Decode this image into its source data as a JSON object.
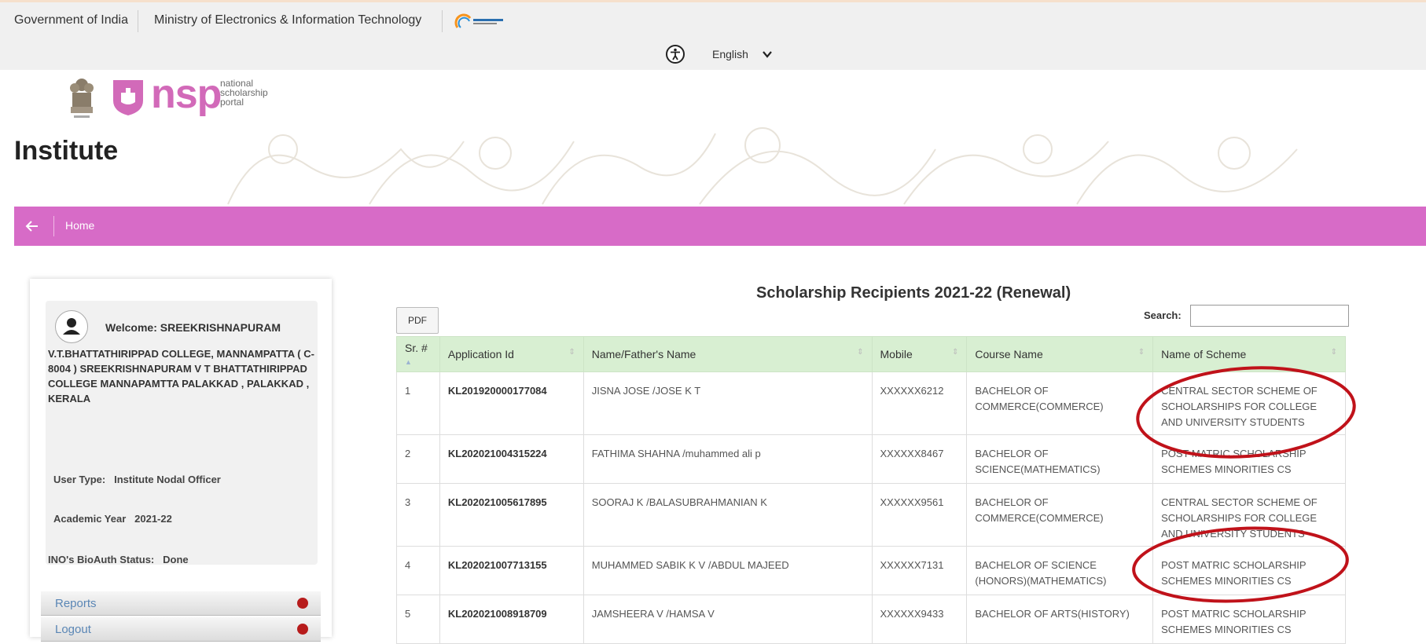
{
  "topbar": {
    "gov": "Government of India",
    "ministry": "Ministry of Electronics & Information Technology",
    "digital_logo": "Digital India",
    "language": "English",
    "accessibility_icon": "accessibility-icon",
    "chevron_icon": "chevron-down-icon"
  },
  "brand": {
    "logo_text": "nsp",
    "logo_sub": [
      "national",
      "scholarship",
      "portal"
    ]
  },
  "page": {
    "title": "Institute"
  },
  "nav": {
    "back_icon": "arrow-left-icon",
    "home": "Home"
  },
  "sidebar": {
    "welcome": "Welcome: SREEKRISHNAPURAM",
    "college": "V.T.BHATTATHIRIPPAD COLLEGE, MANNAMPATTA ( C-8004 ) SREEKRISHNAPURAM V T BHATTATHIRIPPAD COLLEGE MANNAPAMTTA PALAKKAD , PALAKKAD , KERALA",
    "user_type_label": "User Type:",
    "user_type": "Institute Nodal Officer",
    "academic_year_label": "Academic Year",
    "academic_year": "2021-22",
    "bioauth_label": "INO's BioAuth Status:",
    "bioauth": "Done",
    "menu": [
      {
        "label": "Reports"
      },
      {
        "label": "Logout"
      }
    ]
  },
  "report": {
    "title": "Scholarship Recipients 2021-22 (Renewal)",
    "pdf_button": "PDF",
    "search_label": "Search:",
    "search_value": "",
    "columns": [
      "Sr. #",
      "Application Id",
      "Name/Father's Name",
      "Mobile",
      "Course Name",
      "Name of Scheme"
    ],
    "rows": [
      {
        "sr": "1",
        "app_id": "KL201920000177084",
        "name": "JISNA JOSE /JOSE K T",
        "mobile": "XXXXXX6212",
        "course": "BACHELOR OF COMMERCE(COMMERCE)",
        "scheme": "CENTRAL SECTOR SCHEME OF SCHOLARSHIPS FOR COLLEGE AND UNIVERSITY STUDENTS"
      },
      {
        "sr": "2",
        "app_id": "KL202021004315224",
        "name": "FATHIMA SHAHNA /muhammed ali p",
        "mobile": "XXXXXX8467",
        "course": "BACHELOR OF SCIENCE(MATHEMATICS)",
        "scheme": "POST MATRIC SCHOLARSHIP SCHEMES MINORITIES CS"
      },
      {
        "sr": "3",
        "app_id": "KL202021005617895",
        "name": "SOORAJ K /BALASUBRAHMANIAN K",
        "mobile": "XXXXXX9561",
        "course": "BACHELOR OF COMMERCE(COMMERCE)",
        "scheme": "CENTRAL SECTOR SCHEME OF SCHOLARSHIPS FOR COLLEGE AND UNIVERSITY STUDENTS"
      },
      {
        "sr": "4",
        "app_id": "KL202021007713155",
        "name": "MUHAMMED SABIK K V /ABDUL MAJEED",
        "mobile": "XXXXXX7131",
        "course": "BACHELOR OF SCIENCE (HONORS)(MATHEMATICS)",
        "scheme": "POST MATRIC SCHOLARSHIP SCHEMES MINORITIES CS"
      },
      {
        "sr": "5",
        "app_id": "KL202021008918709",
        "name": "JAMSHEERA V /HAMSA V",
        "mobile": "XXXXXX9433",
        "course": "BACHELOR OF ARTS(HISTORY)",
        "scheme": "POST MATRIC SCHOLARSHIP SCHEMES MINORITIES CS"
      }
    ]
  },
  "colors": {
    "accent": "#d76bc7",
    "header_bg": "#f0f0f0",
    "table_header": "#d8efd2",
    "annotation": "#c0121a"
  }
}
